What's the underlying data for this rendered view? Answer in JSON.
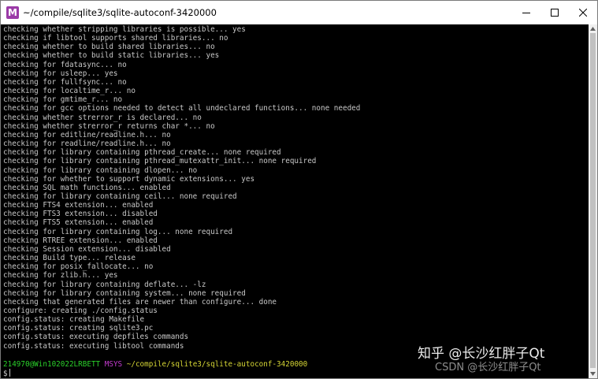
{
  "window": {
    "title": "~/compile/sqlite3/sqlite-autoconf-3420000",
    "icon_label": "M",
    "icon_color": "#9b3aa7"
  },
  "terminal": {
    "output_lines": [
      "checking whether stripping libraries is possible... yes",
      "checking if libtool supports shared libraries... no",
      "checking whether to build shared libraries... no",
      "checking whether to build static libraries... yes",
      "checking for fdatasync... no",
      "checking for usleep... yes",
      "checking for fullfsync... no",
      "checking for localtime_r... no",
      "checking for gmtime_r... no",
      "checking for gcc options needed to detect all undeclared functions... none needed",
      "checking whether strerror_r is declared... no",
      "checking whether strerror_r returns char *... no",
      "checking for editline/readline.h... no",
      "checking for readline/readline.h... no",
      "checking for library containing pthread_create... none required",
      "checking for library containing pthread_mutexattr_init... none required",
      "checking for library containing dlopen... no",
      "checking for whether to support dynamic extensions... yes",
      "checking SQL math functions... enabled",
      "checking for library containing ceil... none required",
      "checking FTS4 extension... enabled",
      "checking FTS3 extension... disabled",
      "checking FTS5 extension... enabled",
      "checking for library containing log... none required",
      "checking RTREE extension... enabled",
      "checking Session extension... disabled",
      "checking Build type... release",
      "checking for posix_fallocate... no",
      "checking for zlib.h... yes",
      "checking for library containing deflate... -lz",
      "checking for library containing system... none required",
      "checking that generated files are newer than configure... done",
      "configure: creating ./config.status",
      "config.status: creating Makefile",
      "config.status: creating sqlite3.pc",
      "config.status: executing depfiles commands",
      "config.status: executing libtool commands"
    ],
    "prompt": {
      "user_host": "214970@Win102022LRBETT",
      "env": "MSYS",
      "path": "~/compile/sqlite3/sqlite-autoconf-3420000",
      "symbol": "$"
    },
    "colors": {
      "background": "#000000",
      "text": "#c8c8c8",
      "user_host": "#2bd12b",
      "env": "#c53cd0",
      "path": "#d6d635"
    }
  },
  "watermark": {
    "line1": "知乎 @长沙红胖子Qt",
    "line2": "CSDN @长沙红胖子Qt"
  }
}
